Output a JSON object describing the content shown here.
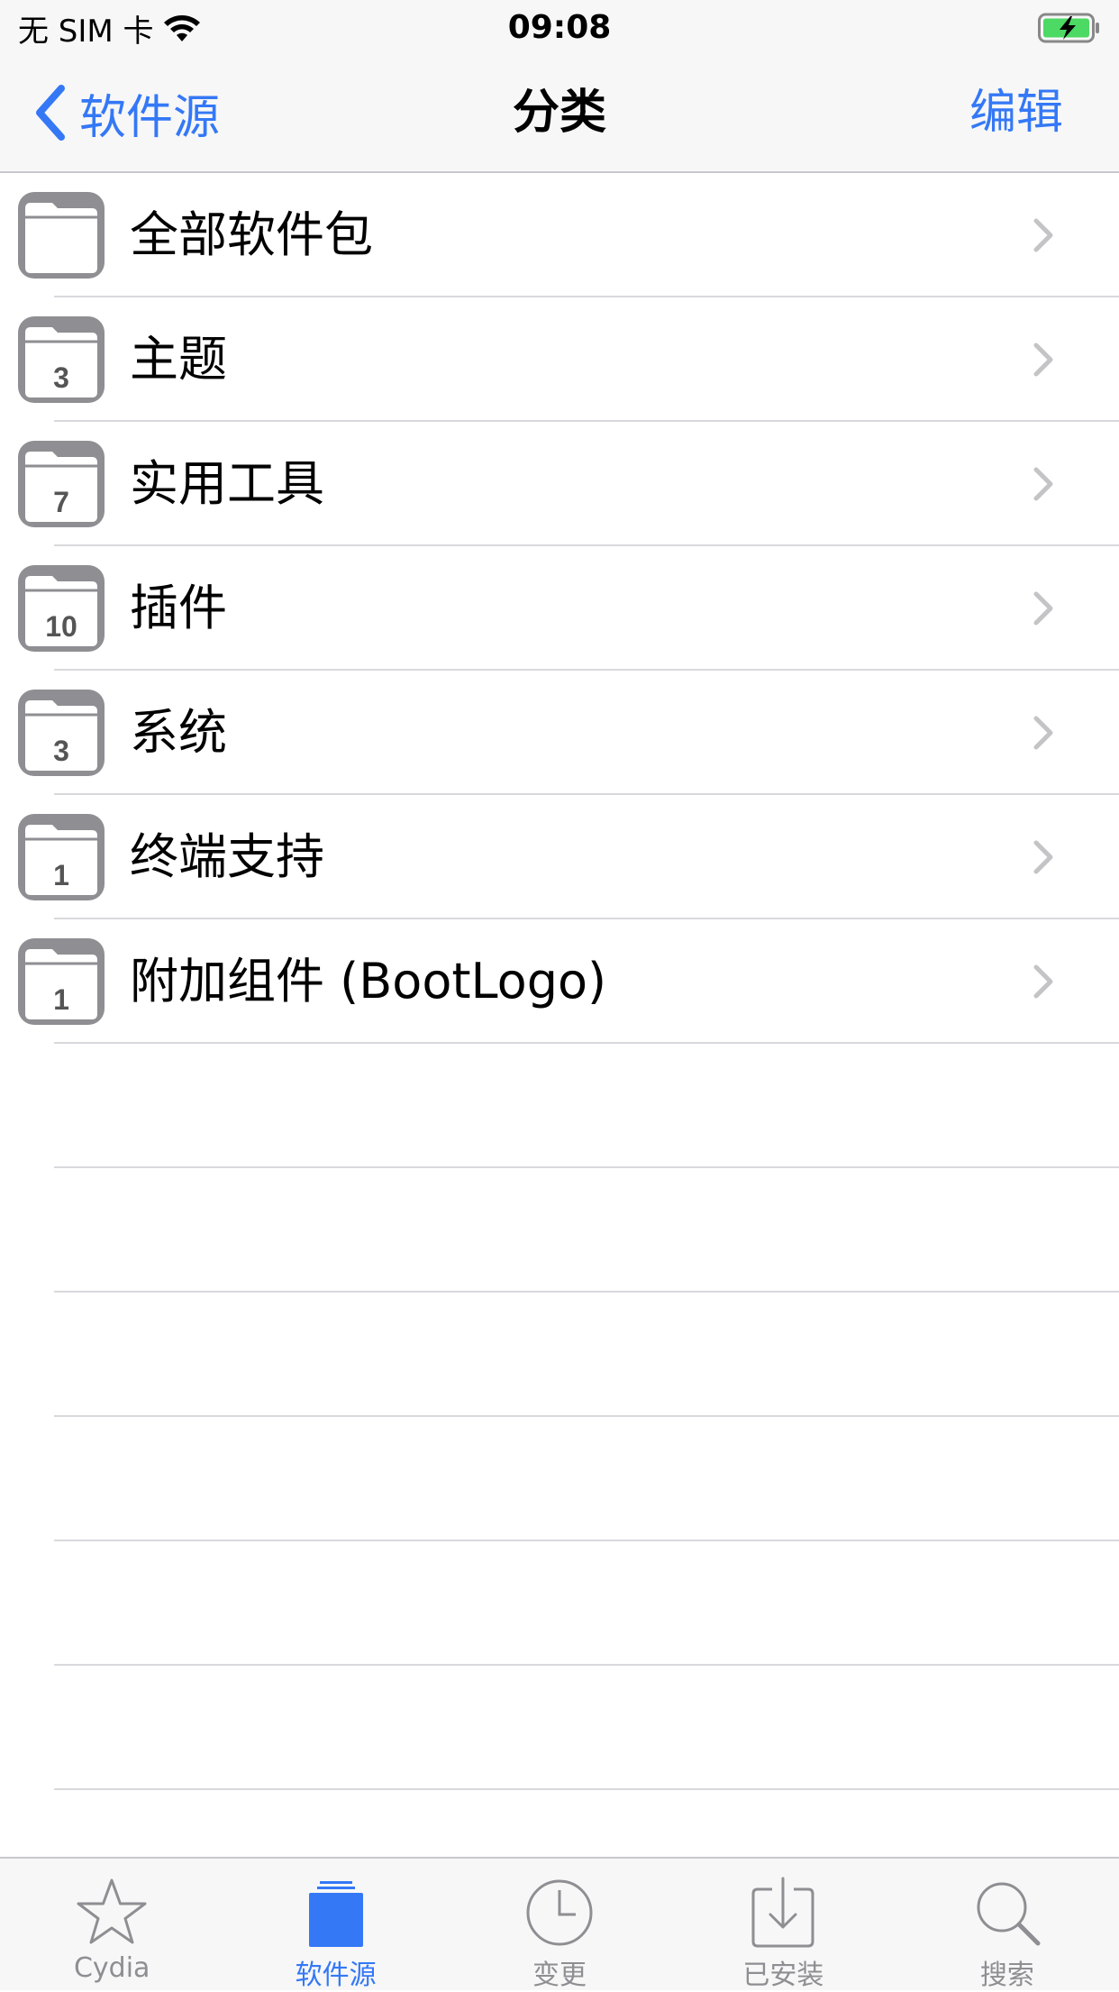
{
  "status": {
    "carrier": "无 SIM 卡",
    "time": "09:08",
    "battery_icon": "battery-charging-icon",
    "wifi_icon": "wifi-icon"
  },
  "nav": {
    "back_label": "软件源",
    "title": "分类",
    "edit_label": "编辑"
  },
  "categories": [
    {
      "label": "全部软件包",
      "count": ""
    },
    {
      "label": "主题",
      "count": "3"
    },
    {
      "label": "实用工具",
      "count": "7"
    },
    {
      "label": "插件",
      "count": "10"
    },
    {
      "label": "系统",
      "count": "3"
    },
    {
      "label": "终端支持",
      "count": "1"
    },
    {
      "label": "附加组件 (BootLogo)",
      "count": "1"
    }
  ],
  "tabs": [
    {
      "label": "Cydia",
      "icon": "star-icon",
      "active": false
    },
    {
      "label": "软件源",
      "icon": "sources-icon",
      "active": true
    },
    {
      "label": "变更",
      "icon": "clock-icon",
      "active": false
    },
    {
      "label": "已安装",
      "icon": "download-icon",
      "active": false
    },
    {
      "label": "搜索",
      "icon": "search-icon",
      "active": false
    }
  ],
  "colors": {
    "accent": "#3478f6",
    "folder": "#8e8e93",
    "battery": "#4cd964"
  }
}
